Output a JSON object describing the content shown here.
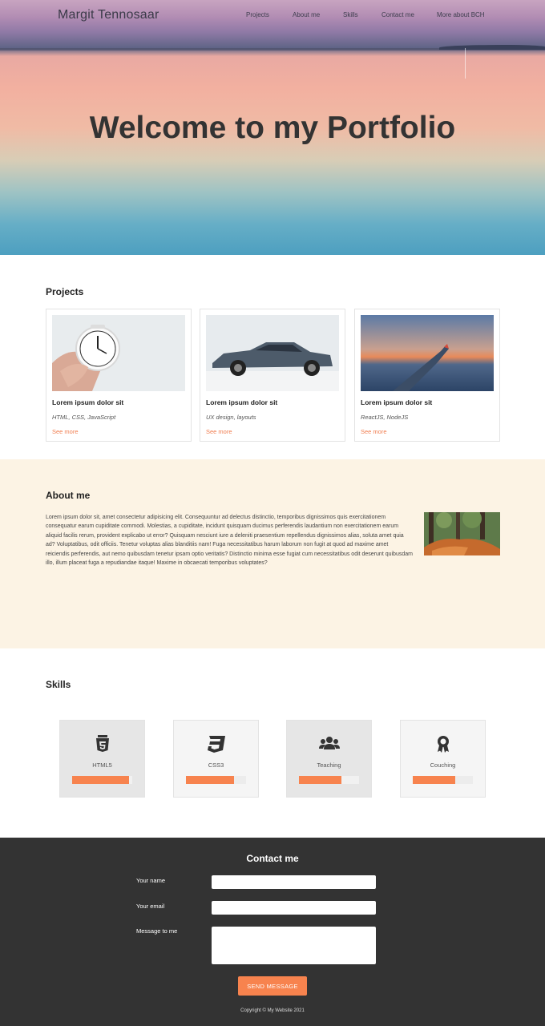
{
  "header": {
    "brand": "Margit Tennosaar",
    "nav": [
      "Projects",
      "About me",
      "Skills",
      "Contact me",
      "More about BCH"
    ]
  },
  "hero": {
    "title": "Welcome to my Portfolio"
  },
  "projects": {
    "heading": "Projects",
    "cards": [
      {
        "title": "Lorem ipsum dolor sit",
        "tags": "HTML, CSS, JavaScript",
        "link": "See more",
        "image": "alarm-clock-photo"
      },
      {
        "title": "Lorem ipsum dolor sit",
        "tags": "UX design, layouts",
        "link": "See more",
        "image": "car-photo"
      },
      {
        "title": "Lorem ipsum dolor sit",
        "tags": "ReactJS, NodeJS",
        "link": "See more",
        "image": "airplane-wing-photo"
      }
    ]
  },
  "about": {
    "heading": "About me",
    "text": "Lorem ipsum dolor sit, amet consectetur adipisicing elit. Consequuntur ad delectus distinctio, temporibus dignissimos quis exercitationem consequatur earum cupiditate commodi. Molestias, a cupiditate, incidunt quisquam ducimus perferendis laudantium non exercitationem earum aliquid facilis rerum, provident explicabo ut error? Quisquam nesciunt iure a deleniti praesentium repellendus dignissimos alias, soluta amet quia ad? Voluptatibus, odit officiis. Tenetur voluptas alias blanditiis nam! Fuga necessitatibus harum laborum non fugit at quod ad maxime amet reiciendis perferendis, aut nemo quibusdam tenetur ipsam optio veritatis? Distinctio minima esse fugiat cum necessitatibus odit deserunt quibusdam illo, illum placeat fuga a repudiandae itaque! Maxime in obcaecati temporibus voluptates?",
    "image": "fox-photo"
  },
  "skills": {
    "heading": "Skills",
    "items": [
      {
        "name": "HTML5",
        "icon": "html5-icon",
        "level": 0.95
      },
      {
        "name": "CSS3",
        "icon": "css3-icon",
        "level": 0.8
      },
      {
        "name": "Teaching",
        "icon": "users-icon",
        "level": 0.7
      },
      {
        "name": "Couching",
        "icon": "award-icon",
        "level": 0.7
      }
    ]
  },
  "contact": {
    "heading": "Contact me",
    "name_label": "Your name",
    "email_label": "Your email",
    "message_label": "Message to me",
    "send_label": "SEND MESSAGE",
    "copyright": "Copyright © My Website 2021"
  },
  "colors": {
    "accent": "#f7834e",
    "footer_bg": "#333333",
    "about_bg": "#fcf3e4"
  }
}
